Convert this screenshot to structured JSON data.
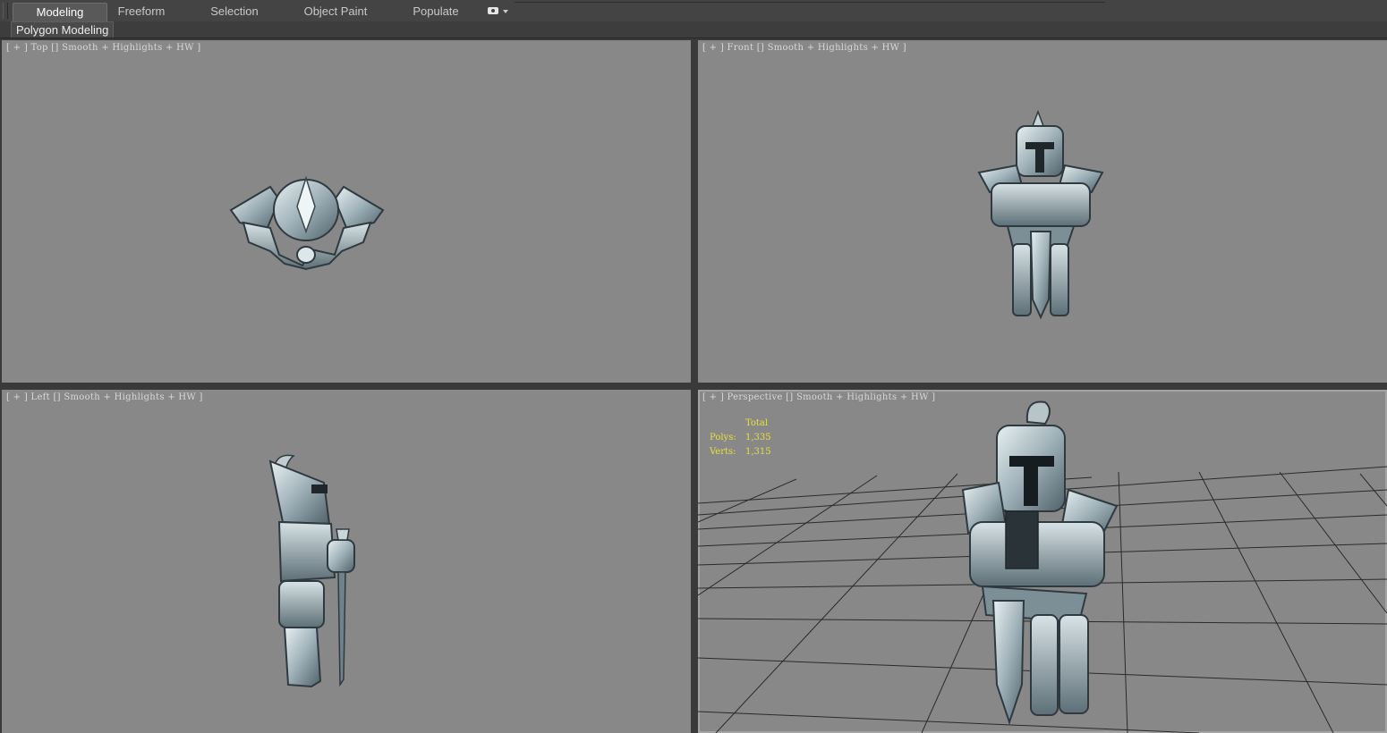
{
  "ribbon": {
    "tabs": [
      {
        "label": "Modeling",
        "active": true
      },
      {
        "label": "Freeform",
        "active": false
      },
      {
        "label": "Selection",
        "active": false
      },
      {
        "label": "Object Paint",
        "active": false
      },
      {
        "label": "Populate",
        "active": false
      }
    ],
    "dropdown_icon": "eye-icon"
  },
  "panel": {
    "label": "Polygon Modeling"
  },
  "viewports": {
    "top": {
      "label": "[ + ] Top [] Smooth + Highlights + HW ]"
    },
    "front": {
      "label": "[ + ] Front [] Smooth + Highlights + HW ]"
    },
    "left": {
      "label": "[ + ] Left [] Smooth + Highlights + HW ]"
    },
    "perspective": {
      "label": "[ + ] Perspective [] Smooth + Highlights + HW ]",
      "stats": {
        "heading": "Total",
        "polys_label": "Polys:",
        "polys_value": "1,335",
        "verts_label": "Verts:",
        "verts_value": "1,315"
      }
    }
  },
  "colors": {
    "viewport_bg": "#888888",
    "stats_text": "#e8e13a",
    "armor_light": "#c9d6da",
    "armor_dark": "#4a5a62"
  }
}
